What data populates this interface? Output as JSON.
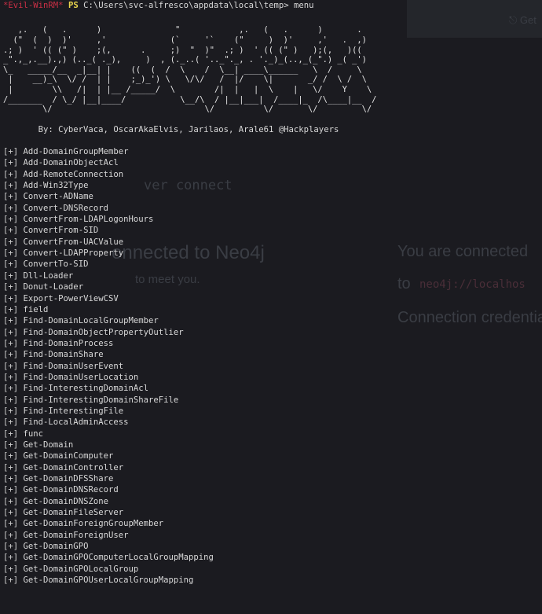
{
  "background": {
    "ghost_top_right": "⎋ Get",
    "ghost_server_connect": "ver connect",
    "ghost_connected": "onnected to Neo4j",
    "ghost_nice_meet": "to meet you.",
    "ghost_you_are_connected": "You are connected",
    "ghost_to": "to",
    "ghost_uri": "neo4j://localhos",
    "ghost_credentials": "Connection credentia"
  },
  "terminal": {
    "prompt_tag": "*Evil-WinRM*",
    "prompt_ps": "PS",
    "prompt_path": "C:\\Users\\svc-alfresco\\appdata\\local\\temp>",
    "command": "menu",
    "banner": "   ,.   (   .      )               \"            ,.   (   .      )       .\n  (\"  (  )  )'     ,'             (`     '`    (\"     )  )'     ,'   .  ,)\n.; )  ' (( (\" )    ;(,      .     ;)  \"  )\"  .; )  ' (( (\" )   );(,   )((\n_\".,_,.__).,) (.._( ._),     )  , (._..( '.._\"._, . '._)_(..,_(_\".) _( _')\n\\_   _____/__  _|__| |    ((  (  /  \\    /  \\__| ____\\______   \\  /     \\\n |    __)_\\  \\/ /  | |    ;_)_') \\   \\/\\/   /  |/    \\|       _/ /  \\ /  \\\n |        \\\\   /|  | |__ /_____/  \\        /|  |   |  \\    |   \\/    Y    \\\n/_______  / \\_/ |__|____/           \\__/\\  / |__|___|  /____|_  /\\____|__  /\n        \\/                               \\/          \\/       \\/         \\/",
    "credits": "       By: CyberVaca, OscarAkaElvis, Jarilaos, Arale61 @Hackplayers",
    "item_prefix": "[+]",
    "menu_items": [
      "Add-DomainGroupMember",
      "Add-DomainObjectAcl",
      "Add-RemoteConnection",
      "Add-Win32Type",
      "Convert-ADName",
      "Convert-DNSRecord",
      "ConvertFrom-LDAPLogonHours",
      "ConvertFrom-SID",
      "ConvertFrom-UACValue",
      "Convert-LDAPProperty",
      "ConvertTo-SID",
      "Dll-Loader",
      "Donut-Loader",
      "Export-PowerViewCSV",
      "field",
      "Find-DomainLocalGroupMember",
      "Find-DomainObjectPropertyOutlier",
      "Find-DomainProcess",
      "Find-DomainShare",
      "Find-DomainUserEvent",
      "Find-DomainUserLocation",
      "Find-InterestingDomainAcl",
      "Find-InterestingDomainShareFile",
      "Find-InterestingFile",
      "Find-LocalAdminAccess",
      "func",
      "Get-Domain",
      "Get-DomainComputer",
      "Get-DomainController",
      "Get-DomainDFSShare",
      "Get-DomainDNSRecord",
      "Get-DomainDNSZone",
      "Get-DomainFileServer",
      "Get-DomainForeignGroupMember",
      "Get-DomainForeignUser",
      "Get-DomainGPO",
      "Get-DomainGPOComputerLocalGroupMapping",
      "Get-DomainGPOLocalGroup",
      "Get-DomainGPOUserLocalGroupMapping"
    ]
  },
  "colors": {
    "background": "#1b1b20",
    "prompt_tag": "#c92f45",
    "prompt_ps": "#e8d44d",
    "text": "#d8d8d8"
  }
}
